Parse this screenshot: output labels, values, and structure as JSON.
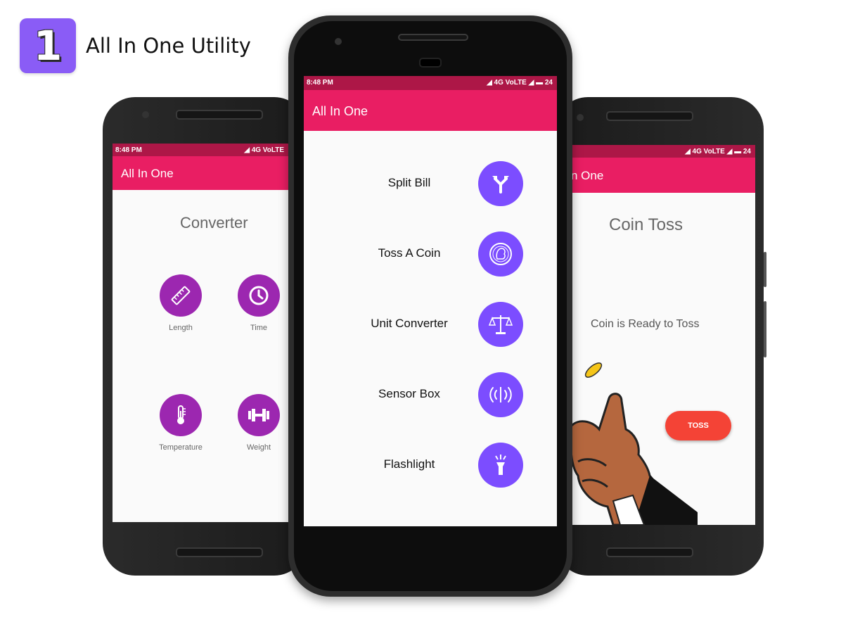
{
  "brand": {
    "logo_digit": "1",
    "title": "All In One Utility"
  },
  "colors": {
    "status_bar": "#ad1747",
    "app_bar": "#e91e63",
    "converter_accent": "#9c27b0",
    "list_accent": "#7c4dff",
    "toss_button": "#f44336"
  },
  "left_screen": {
    "status": {
      "time": "8:48 PM",
      "network": "◢ 4G VoLTE"
    },
    "app_title": "All In One",
    "section_title": "Converter",
    "items": [
      {
        "label": "Length",
        "icon": "ruler-icon"
      },
      {
        "label": "Time",
        "icon": "clock-icon"
      },
      {
        "label": "Temperature",
        "icon": "thermometer-icon"
      },
      {
        "label": "Weight",
        "icon": "dumbbell-icon"
      }
    ]
  },
  "center_screen": {
    "status": {
      "time": "8:48 PM",
      "network": "◢ 4G VoLTE ◢ ▬ 24"
    },
    "app_title": "All In One",
    "items": [
      {
        "label": "Split Bill",
        "icon": "split-arrows-icon"
      },
      {
        "label": "Toss A Coin",
        "icon": "coin-icon"
      },
      {
        "label": "Unit Converter",
        "icon": "scale-icon"
      },
      {
        "label": "Sensor Box",
        "icon": "sensor-waves-icon"
      },
      {
        "label": "Flashlight",
        "icon": "flashlight-icon"
      }
    ]
  },
  "right_screen": {
    "status": {
      "network": "◢ 4G VoLTE ◢ ▬ 24"
    },
    "app_title": "n One",
    "section_title": "Coin Toss",
    "status_text": "Coin is Ready to Toss",
    "toss_button": "TOSS"
  }
}
